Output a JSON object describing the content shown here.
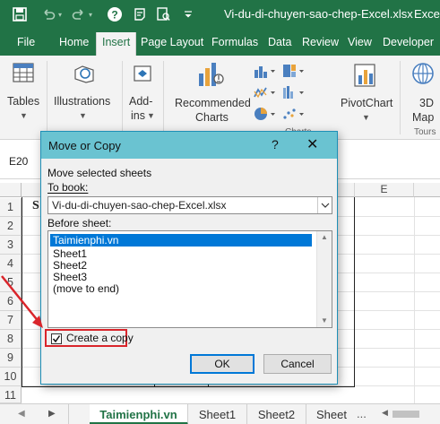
{
  "title_bar": {
    "document_title": "Vi-du-di-chuyen-sao-chep-Excel.xlsx",
    "app_name": "Excel"
  },
  "ribbon_tabs": [
    "File",
    "Home",
    "Insert",
    "Page Layout",
    "Formulas",
    "Data",
    "Review",
    "View",
    "Developer"
  ],
  "active_tab": "Insert",
  "ribbon": {
    "tables": "Tables",
    "illustrations": "Illustrations",
    "addins_line1": "Add-",
    "addins_line2": "ins",
    "recommended_line1": "Recommended",
    "recommended_line2": "Charts",
    "charts_group": "Charts",
    "pivotchart": "PivotChart",
    "map_line1": "3D",
    "map_line2": "Map",
    "tours": "Tours"
  },
  "name_box": "E20",
  "columns": [
    "E"
  ],
  "rows": [
    "1",
    "2",
    "3",
    "4",
    "5",
    "6",
    "7",
    "8",
    "9",
    "10",
    "11"
  ],
  "cell_fragment": "S",
  "sheet_tabs": [
    "Taimienphi.vn",
    "Sheet1",
    "Sheet2",
    "Sheet"
  ],
  "active_sheet": "Taimienphi.vn",
  "dialog": {
    "title": "Move or Copy",
    "help": "?",
    "close": "✕",
    "move_label": "Move selected sheets",
    "to_book_label": "To book:",
    "to_book_value": "Vi-du-di-chuyen-sao-chep-Excel.xlsx",
    "before_sheet_label": "Before sheet:",
    "sheets": [
      "Taimienphi.vn",
      "Sheet1",
      "Sheet2",
      "Sheet3",
      "(move to end)"
    ],
    "selected_sheet": "Taimienphi.vn",
    "create_copy_label": "Create a copy",
    "create_copy_checked": true,
    "ok_label": "OK",
    "cancel_label": "Cancel"
  },
  "colors": {
    "excel_green": "#217346",
    "dialog_title": "#6ac3d1",
    "selection_blue": "#0078d7",
    "annotation_red": "#d9252b"
  }
}
